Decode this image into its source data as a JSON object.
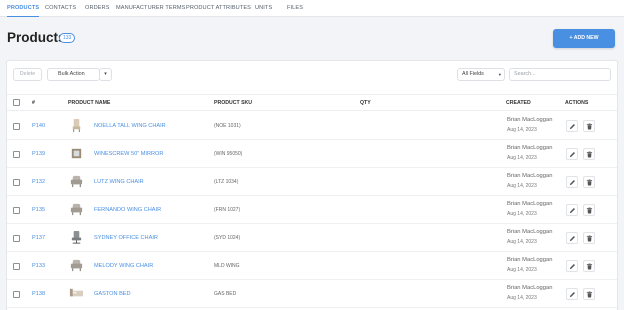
{
  "tabs": [
    "PRODUCTS",
    "CONTACTS",
    "ORDERS",
    "MANUFACTURER TERMS",
    "PRODUCT ATTRIBUTES",
    "UNITS",
    "FILES"
  ],
  "header": {
    "title": "Products",
    "count": "133",
    "add_button": "+ ADD NEW"
  },
  "toolbar": {
    "delete_label": "Delete",
    "bulk_action_label": "Bulk Action",
    "fields_select": "All Fields",
    "search_placeholder": "Search..."
  },
  "table": {
    "columns": [
      "#",
      "PRODUCT NAME",
      "PRODUCT SKU",
      "QTY",
      "CREATED",
      "ACTIONS"
    ],
    "rows": [
      {
        "id": "P140",
        "name": "NOELLA TALL WING CHAIR",
        "sku": "(NOE 1031)",
        "created_by": "Brian MacLoggan",
        "created_date": "Aug 14, 2023",
        "thumb": "tall-chair"
      },
      {
        "id": "P139",
        "name": "WINESCREW 50\" MIRROR",
        "sku": "(WIN 95050)",
        "created_by": "Brian MacLoggan",
        "created_date": "Aug 14, 2023",
        "thumb": "mirror"
      },
      {
        "id": "P132",
        "name": "LUTZ WING CHAIR",
        "sku": "(LTZ 1034)",
        "created_by": "Brian MacLoggan",
        "created_date": "Aug 14, 2023",
        "thumb": "wing-chair"
      },
      {
        "id": "P135",
        "name": "FERNANDO WING CHAIR",
        "sku": "(FRN 1027)",
        "created_by": "Brian MacLoggan",
        "created_date": "Aug 14, 2023",
        "thumb": "wing-chair"
      },
      {
        "id": "P137",
        "name": "SYDNEY OFFICE CHAIR",
        "sku": "(SYD 1024)",
        "created_by": "Brian MacLoggan",
        "created_date": "Aug 14, 2023",
        "thumb": "office-chair"
      },
      {
        "id": "P133",
        "name": "MELODY WING CHAIR",
        "sku": "MLD WING",
        "created_by": "Brian MacLoggan",
        "created_date": "Aug 14, 2023",
        "thumb": "wing-chair"
      },
      {
        "id": "P138",
        "name": "GASTON BED",
        "sku": "GAS BED",
        "created_by": "Brian MacLoggan",
        "created_date": "Aug 14, 2023",
        "thumb": "bed"
      }
    ]
  },
  "icons": {
    "edit": "pencil-icon",
    "delete": "trash-icon",
    "dropdown": "caret-down-icon"
  },
  "colors": {
    "accent": "#4a90e2",
    "background": "#f2f4f7"
  }
}
